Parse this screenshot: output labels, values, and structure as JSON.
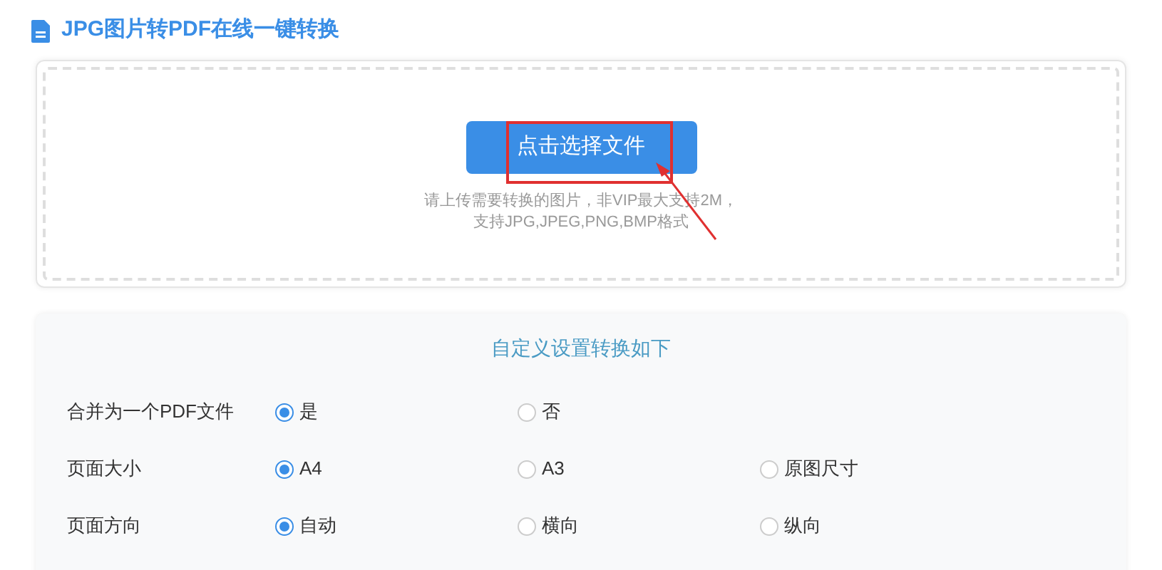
{
  "title": "JPG图片转PDF在线一键转换",
  "upload": {
    "button": "点击选择文件",
    "hint_lines": [
      "请上传需要转换的图片，非VIP最大支持2M，",
      "支持JPG,JPEG,PNG,BMP格式"
    ]
  },
  "settings": {
    "heading": "自定义设置转换如下",
    "rows": [
      {
        "label": "合并为一个PDF文件",
        "options": [
          {
            "label": "是",
            "selected": true
          },
          {
            "label": "否",
            "selected": false
          }
        ]
      },
      {
        "label": "页面大小",
        "options": [
          {
            "label": "A4",
            "selected": true
          },
          {
            "label": "A3",
            "selected": false
          },
          {
            "label": "原图尺寸",
            "selected": false
          }
        ]
      },
      {
        "label": "页面方向",
        "options": [
          {
            "label": "自动",
            "selected": true
          },
          {
            "label": "横向",
            "selected": false
          },
          {
            "label": "纵向",
            "selected": false
          }
        ]
      }
    ]
  }
}
